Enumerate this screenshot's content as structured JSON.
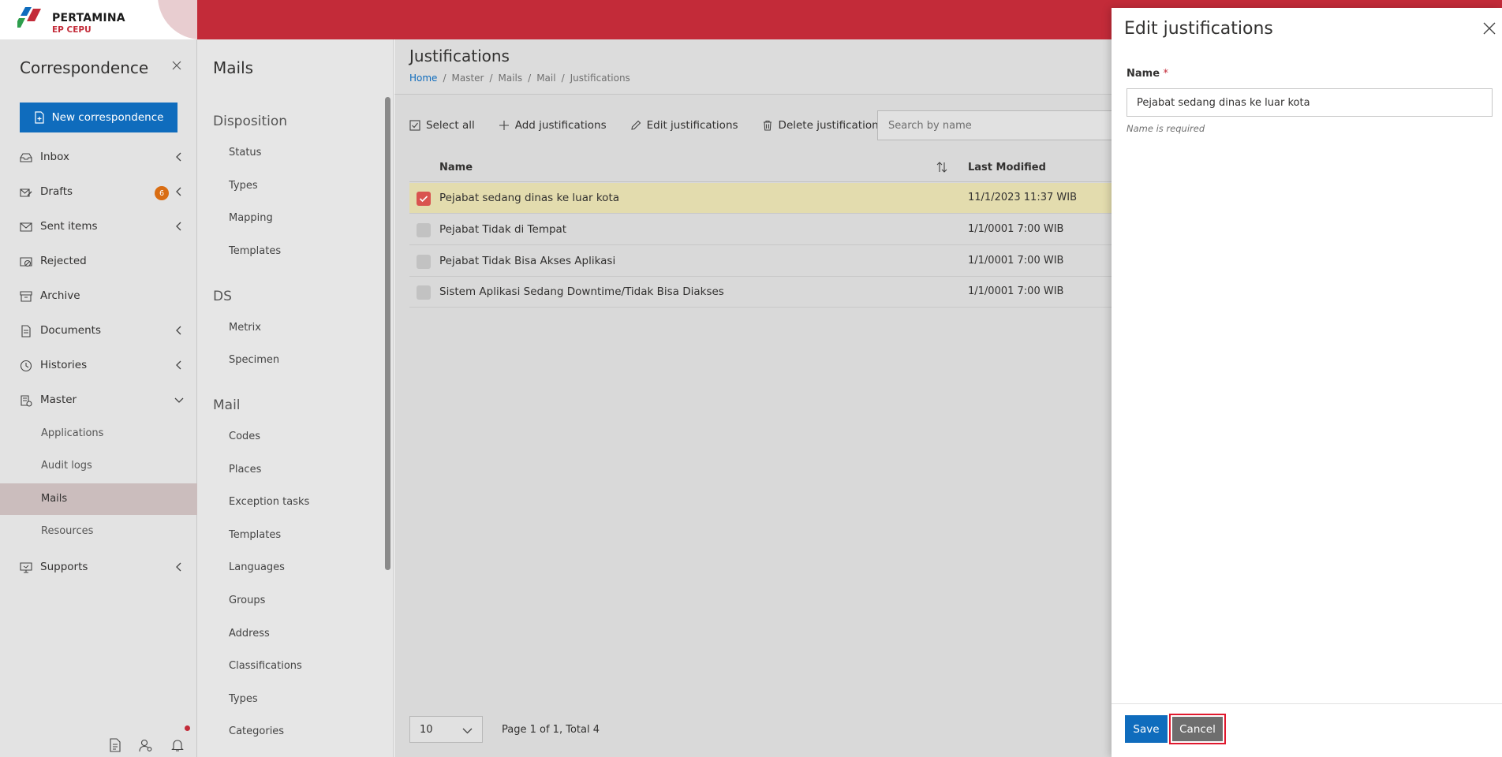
{
  "brand": {
    "name": "PERTAMINA",
    "sub": "EP CEPU",
    "accent": "#c32b39",
    "primary": "#0f6cbd"
  },
  "leftnav": {
    "title": "Correspondence",
    "new_button": "New correspondence",
    "items": [
      {
        "label": "Inbox",
        "icon": "inbox-icon",
        "chevron": "left"
      },
      {
        "label": "Drafts",
        "icon": "drafts-icon",
        "badge": "6",
        "chevron": "left"
      },
      {
        "label": "Sent items",
        "icon": "sent-icon",
        "chevron": "left"
      },
      {
        "label": "Rejected",
        "icon": "rejected-icon"
      },
      {
        "label": "Archive",
        "icon": "archive-icon"
      },
      {
        "label": "Documents",
        "icon": "documents-icon",
        "chevron": "left"
      },
      {
        "label": "Histories",
        "icon": "histories-icon",
        "chevron": "left"
      },
      {
        "label": "Master",
        "icon": "master-icon",
        "chevron": "down"
      }
    ],
    "master_sub": [
      {
        "label": "Applications"
      },
      {
        "label": "Audit logs"
      },
      {
        "label": "Mails",
        "active": true
      },
      {
        "label": "Resources"
      }
    ],
    "supports": {
      "label": "Supports",
      "icon": "supports-icon",
      "chevron": "left"
    }
  },
  "mailsnav": {
    "title": "Mails",
    "sections": [
      {
        "title": "Disposition",
        "items": [
          "Status",
          "Types",
          "Mapping",
          "Templates"
        ]
      },
      {
        "title": "DS",
        "items": [
          "Metrix",
          "Specimen"
        ]
      },
      {
        "title": "Mail",
        "items": [
          "Codes",
          "Places",
          "Exception tasks",
          "Templates",
          "Languages",
          "Groups",
          "Address",
          "Classifications",
          "Types",
          "Categories"
        ]
      }
    ]
  },
  "content": {
    "title": "Justifications",
    "breadcrumb": [
      "Home",
      "Master",
      "Mails",
      "Mail",
      "Justifications"
    ],
    "toolbar": {
      "select_all": "Select all",
      "add": "Add justifications",
      "edit": "Edit justifications",
      "delete": "Delete justifications"
    },
    "search_placeholder": "Search by name",
    "columns": {
      "name": "Name",
      "modified": "Last Modified"
    },
    "rows": [
      {
        "name": "Pejabat sedang dinas ke luar kota",
        "modified": "11/1/2023 11:37 WIB",
        "selected": true
      },
      {
        "name": "Pejabat Tidak di Tempat",
        "modified": "1/1/0001 7:00 WIB",
        "selected": false
      },
      {
        "name": "Pejabat Tidak Bisa Akses Aplikasi",
        "modified": "1/1/0001 7:00 WIB",
        "selected": false
      },
      {
        "name": "Sistem Aplikasi Sedang Downtime/Tidak Bisa Diakses",
        "modified": "1/1/0001 7:00 WIB",
        "selected": false
      }
    ],
    "page_size": "10",
    "page_info": "Page 1 of 1, Total 4"
  },
  "panel": {
    "title": "Edit justifications",
    "field_label": "Name",
    "required_mark": "*",
    "field_value": "Pejabat sedang dinas ke luar kota",
    "error": "Name is required",
    "save": "Save",
    "cancel": "Cancel"
  }
}
